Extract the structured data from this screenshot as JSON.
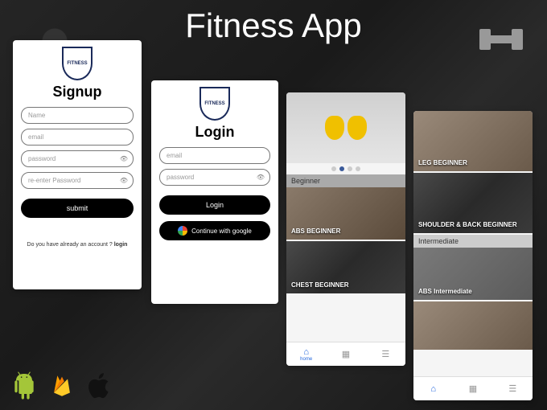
{
  "title": "Fitness App",
  "logo_text": "FITNESS",
  "signup": {
    "heading": "Signup",
    "name_placeholder": "Name",
    "email_placeholder": "email",
    "password_placeholder": "password",
    "repassword_placeholder": "re-enter Password",
    "submit_label": "submit",
    "already_prefix": "Do you have already an account ? ",
    "already_link": "login"
  },
  "login": {
    "heading": "Login",
    "email_placeholder": "email",
    "password_placeholder": "password",
    "login_label": "Login",
    "google_label": "Continue with google"
  },
  "list1": {
    "beginner_label": "Beginner",
    "cards": [
      {
        "label": "ABS BEGINNER"
      },
      {
        "label": "CHEST BEGINNER"
      }
    ],
    "nav": {
      "home": "home"
    }
  },
  "list2": {
    "cards": [
      {
        "label": "LEG BEGINNER"
      },
      {
        "label": "SHOULDER & BACK BEGINNER"
      },
      {
        "label": "Intermediate"
      },
      {
        "label": "ABS Intermediate"
      }
    ]
  }
}
